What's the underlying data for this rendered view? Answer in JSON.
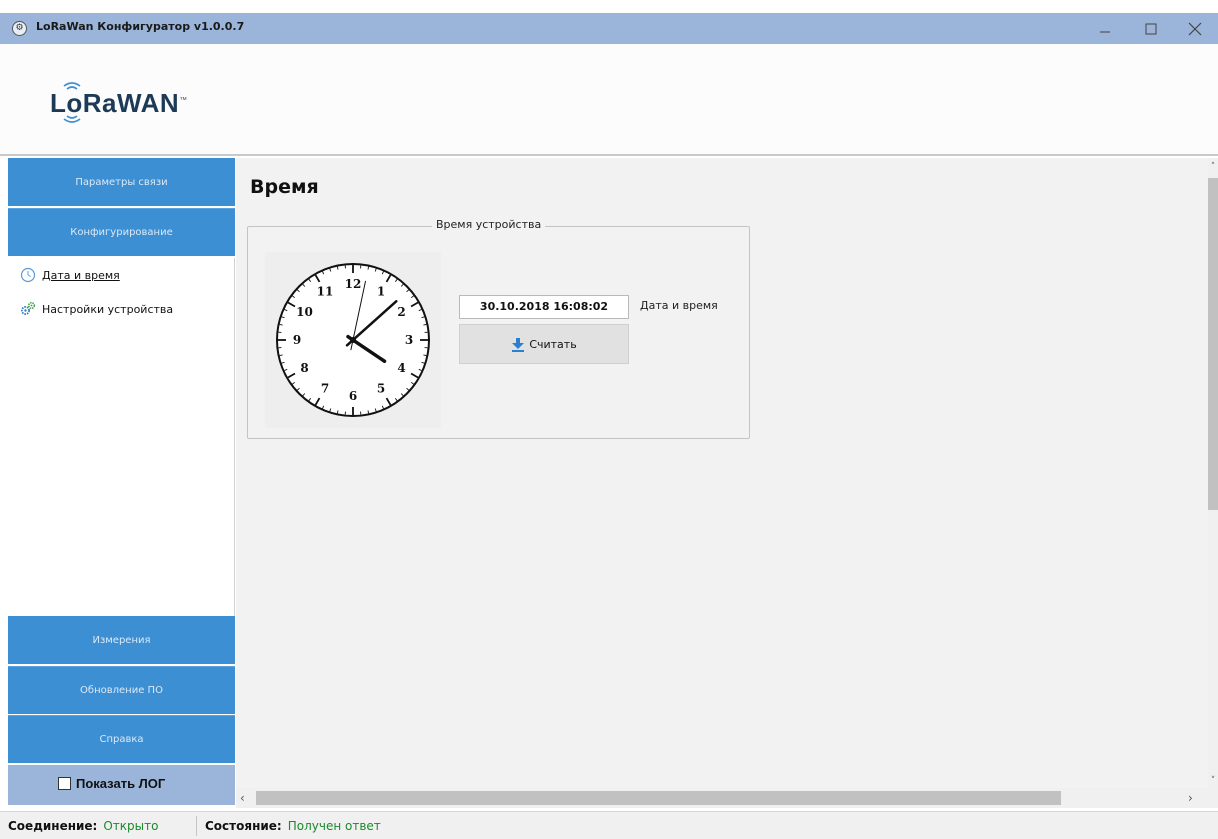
{
  "window": {
    "title": "LoRaWan Конфигуратор v1.0.0.7",
    "icon": "app-icon"
  },
  "header": {
    "logo_text": "LoRaWAN",
    "logo_tm": "™"
  },
  "sidebar": {
    "top_items": [
      {
        "label": "Параметры связи"
      },
      {
        "label": "Конфигурирование"
      }
    ],
    "sub_items": [
      {
        "label": "Дата и время",
        "icon": "clock-icon"
      },
      {
        "label": "Настройки устройства",
        "icon": "gears-icon"
      }
    ],
    "bottom_items": [
      {
        "label": "Измерения"
      },
      {
        "label": "Обновление ПО"
      },
      {
        "label": "Справка"
      }
    ],
    "log_toggle": {
      "label": "Показать ЛОГ",
      "checked": false
    }
  },
  "main": {
    "title": "Время",
    "group_title": "Время устройства",
    "datetime_value": "30.10.2018 16:08:02",
    "datetime_caption": "Дата и время",
    "read_button_label": "Считать",
    "clock": {
      "numbers": [
        "12",
        "1",
        "2",
        "3",
        "4",
        "5",
        "6",
        "7",
        "8",
        "9",
        "10",
        "11"
      ],
      "hour": 16,
      "minute": 8,
      "second": 2
    }
  },
  "statusbar": {
    "connection_label": "Соединение:",
    "connection_value": "Открыто",
    "state_label": "Состояние:",
    "state_value": "Получен ответ"
  },
  "colors": {
    "titlebar": "#9bb4d9",
    "nav": "#3d8fd3",
    "status_ok": "#1a8a2a"
  }
}
